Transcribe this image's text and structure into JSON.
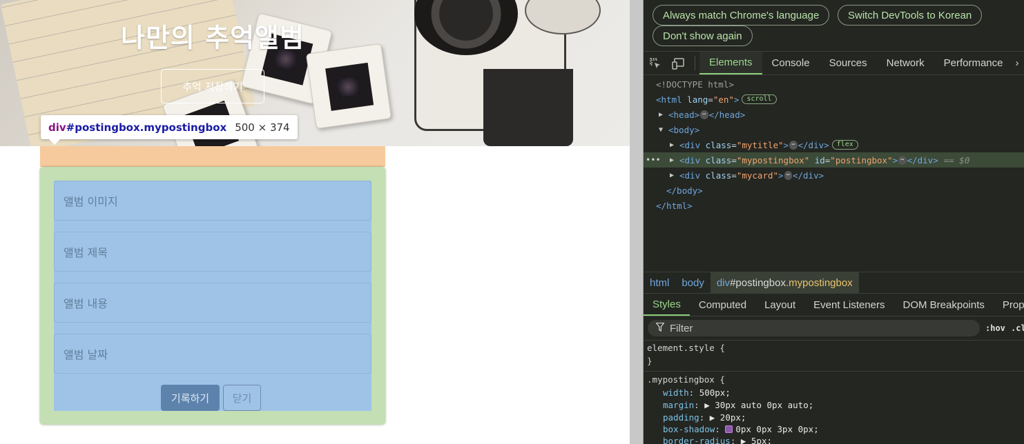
{
  "page": {
    "hero_title": "나만의 추억앨범",
    "hero_button": "추억 저장하기",
    "tooltip": {
      "tag": "div",
      "id": "#postingbox",
      "cls": ".mypostingbox",
      "size": "500 × 374"
    },
    "form": {
      "image_placeholder": "앨범 이미지",
      "title_placeholder": "앨범 제목",
      "content_placeholder": "앨범 내용",
      "date_placeholder": "앨범 날짜",
      "save_button": "기록하기",
      "close_button": "닫기"
    }
  },
  "devtools": {
    "infobar": {
      "always_match": "Always match Chrome's language",
      "switch_korean": "Switch DevTools to Korean",
      "dont_show": "Don't show again"
    },
    "tabs": [
      "Elements",
      "Console",
      "Sources",
      "Network",
      "Performance"
    ],
    "active_tab": "Elements",
    "dom": {
      "doctype": "<!DOCTYPE html>",
      "html_open_tag": "<html",
      "html_attr": "lang",
      "html_attr_val": "\"en\"",
      "html_close_bracket": ">",
      "scroll_badge": "scroll",
      "head_open": "<head>",
      "head_close": "</head>",
      "body_open": "<body>",
      "div_open": "<div",
      "class_attr": "class",
      "id_attr": "id",
      "mytitle_val": "\"mytitle\"",
      "mypostingbox_val": "\"mypostingbox\"",
      "postingbox_val": "\"postingbox\"",
      "mycard_val": "\"mycard\"",
      "div_close": "</div>",
      "flex_badge": "flex",
      "eq0": "== $0",
      "body_close": "</body>",
      "html_close": "</html>",
      "ellipsis": "⋯",
      "gt": ">",
      "eq": "="
    },
    "breadcrumbs": {
      "html": "html",
      "body": "body",
      "div_tag": "div",
      "div_id": "#postingbox",
      "div_cls": ".mypostingbox"
    },
    "subtabs": [
      "Styles",
      "Computed",
      "Layout",
      "Event Listeners",
      "DOM Breakpoints",
      "Prope"
    ],
    "active_subtab": "Styles",
    "filter_placeholder": "Filter",
    "hov": ":hov",
    "cls": ".cl",
    "styles": {
      "element_style": "element.style {",
      "close_brace": "}",
      "selector": ".mypostingbox {",
      "props": [
        {
          "name": "width",
          "value": "500px;"
        },
        {
          "name": "margin",
          "value": "▶ 30px auto 0px auto;"
        },
        {
          "name": "padding",
          "value": "▶ 20px;"
        },
        {
          "name": "box-shadow",
          "value": "0px 0px 3px 0px;"
        },
        {
          "name": "border-radius",
          "value": "▶ 5px;"
        }
      ]
    }
  }
}
